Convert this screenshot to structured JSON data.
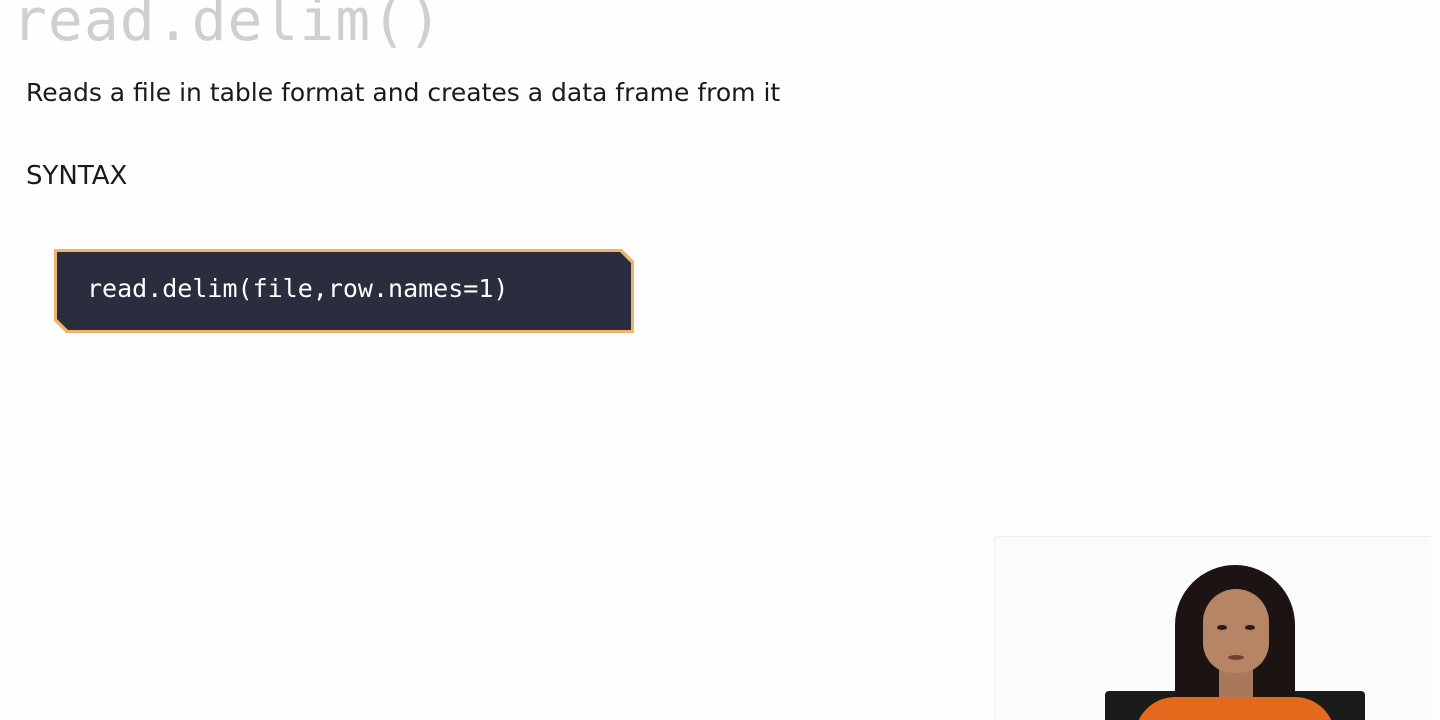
{
  "slide": {
    "title": "read.delim()",
    "description": "Reads a file in table format and creates a data frame from it",
    "syntax_heading": "SYNTAX",
    "code": "read.delim(file,row.names=1)"
  },
  "colors": {
    "title": "#cfcfcf",
    "code_background": "#2a2d3e",
    "code_border": "#f2b26c",
    "code_text": "#ffffff"
  },
  "presenter": {
    "icon": "presenter-video-thumbnail"
  }
}
